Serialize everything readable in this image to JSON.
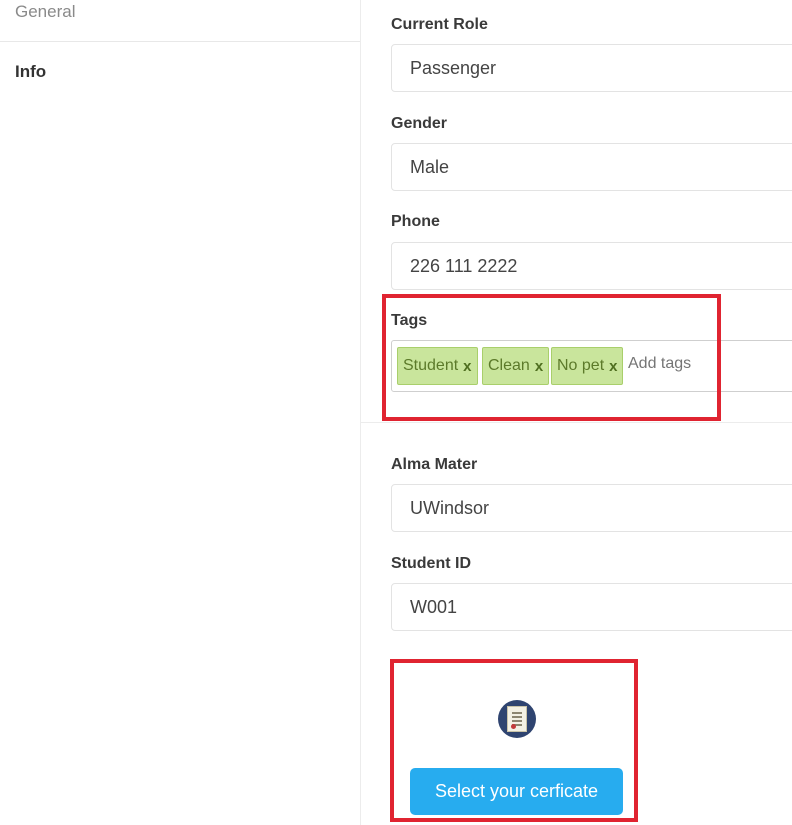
{
  "sidebar": {
    "general_label": "General",
    "info_label": "Info"
  },
  "form": {
    "current_role": {
      "label": "Current Role",
      "value": "Passenger"
    },
    "gender": {
      "label": "Gender",
      "value": "Male"
    },
    "phone": {
      "label": "Phone",
      "value": "226 111 2222"
    },
    "tags": {
      "label": "Tags",
      "items": [
        "Student",
        "Clean",
        "No pet"
      ],
      "remove_glyph": "x",
      "placeholder": "Add tags"
    },
    "alma_mater": {
      "label": "Alma Mater",
      "value": "UWindsor"
    },
    "student_id": {
      "label": "Student ID",
      "value": "W001"
    },
    "certificate": {
      "icon": "certificate-icon",
      "button_label": "Select your cerficate"
    }
  },
  "colors": {
    "highlight": "#e02431",
    "tag_bg": "#c9e59c",
    "button_bg": "#27acef"
  }
}
